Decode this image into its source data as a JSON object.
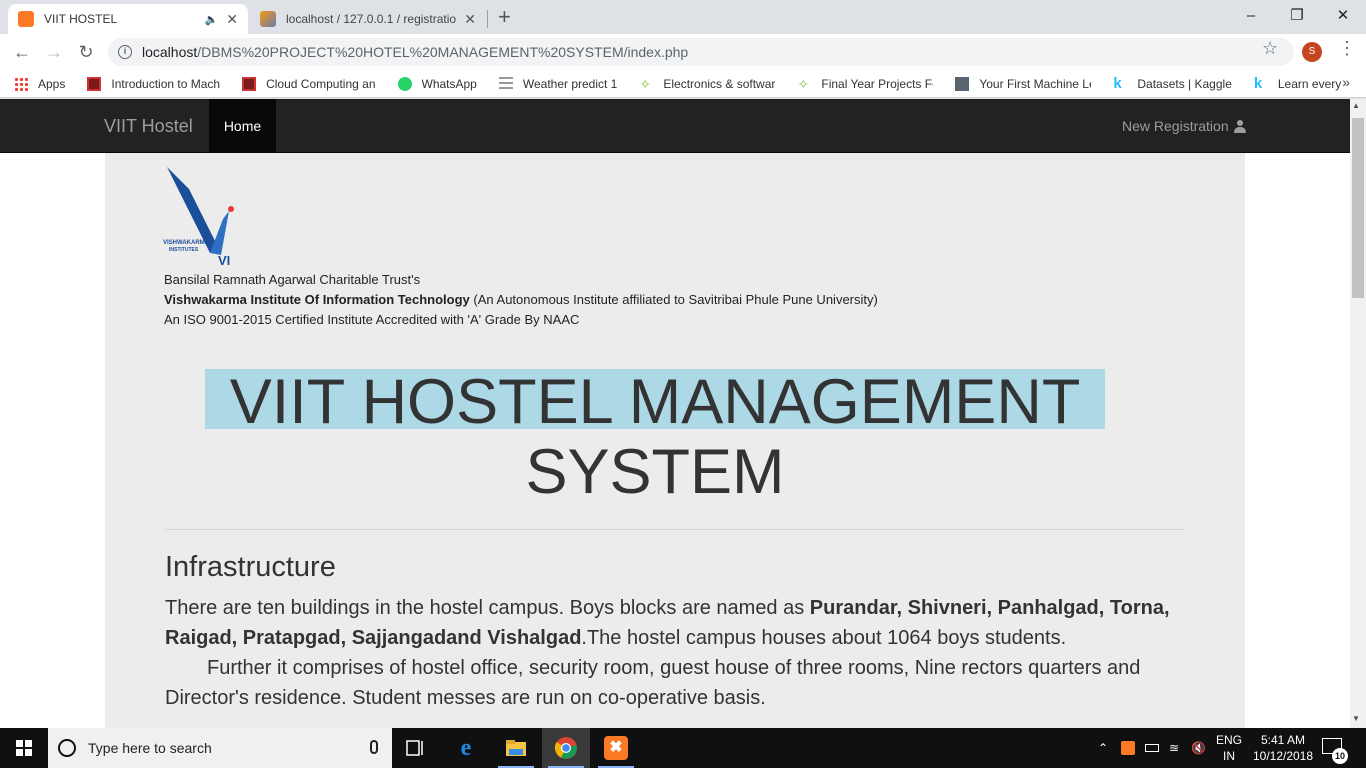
{
  "browser": {
    "tabs": [
      {
        "title": "VIIT HOSTEL",
        "active": true
      },
      {
        "title": "localhost / 127.0.0.1 / registration",
        "active": false
      }
    ],
    "url_host": "localhost",
    "url_path": "/DBMS%20PROJECT%20HOTEL%20MANAGEMENT%20SYSTEM/index.php",
    "profile_initial": "S",
    "bookmarks": [
      {
        "label": "Apps",
        "icon": "apps-grid-icon"
      },
      {
        "label": "Introduction to Mach",
        "icon": "course-icon"
      },
      {
        "label": "Cloud Computing an",
        "icon": "course-icon"
      },
      {
        "label": "WhatsApp",
        "icon": "whatsapp-icon"
      },
      {
        "label": "Weather predict 1",
        "icon": "lines-icon"
      },
      {
        "label": "Electronics & softwar",
        "icon": "leaf-icon"
      },
      {
        "label": "Final Year Projects Fo",
        "icon": "leaf-icon"
      },
      {
        "label": "Your First Machine Le",
        "icon": "profile-photo-icon"
      },
      {
        "label": "Datasets | Kaggle",
        "icon": "kaggle-icon"
      },
      {
        "label": "Learn every",
        "icon": "kaggle-icon"
      }
    ]
  },
  "site": {
    "brand": "VIIT Hostel",
    "nav_home": "Home",
    "nav_register": "New Registration",
    "logo_text_top": "VISHWAKARMA",
    "logo_text_bottom": "INSTITUTES",
    "logo_mark": "VI",
    "trust_line": "Bansilal Ramnath Agarwal Charitable Trust's",
    "institute_name": "Vishwakarma Institute Of Information Technology",
    "institute_note": " (An Autonomous Institute affiliated to Savitribai Phule Pune University)",
    "certification": "An ISO 9001-2015 Certified Institute Accredited with 'A' Grade By NAAC",
    "main_heading": "VIIT HOSTEL MANAGEMENT SYSTEM",
    "section_title": "Infrastructure",
    "para_part1": "There are ten buildings in the hostel campus. Boys blocks are named as ",
    "para_blocks": "Purandar, Shivneri, Panhalgad, Torna, Raigad, Pratapgad, Sajjangadand Vishalgad",
    "para_part2": ".The hostel campus houses about 1064 boys students.",
    "para_part3": "Further it comprises of hostel office, security room, guest house of three rooms, Nine rectors quarters and Director's residence. Student messes are run on co-operative basis.",
    "heading_highlight_color": "#add8e6"
  },
  "taskbar": {
    "search_placeholder": "Type here to search",
    "lang_top": "ENG",
    "lang_bottom": "IN",
    "time": "5:41 AM",
    "date": "10/12/2018",
    "notification_count": "10"
  }
}
